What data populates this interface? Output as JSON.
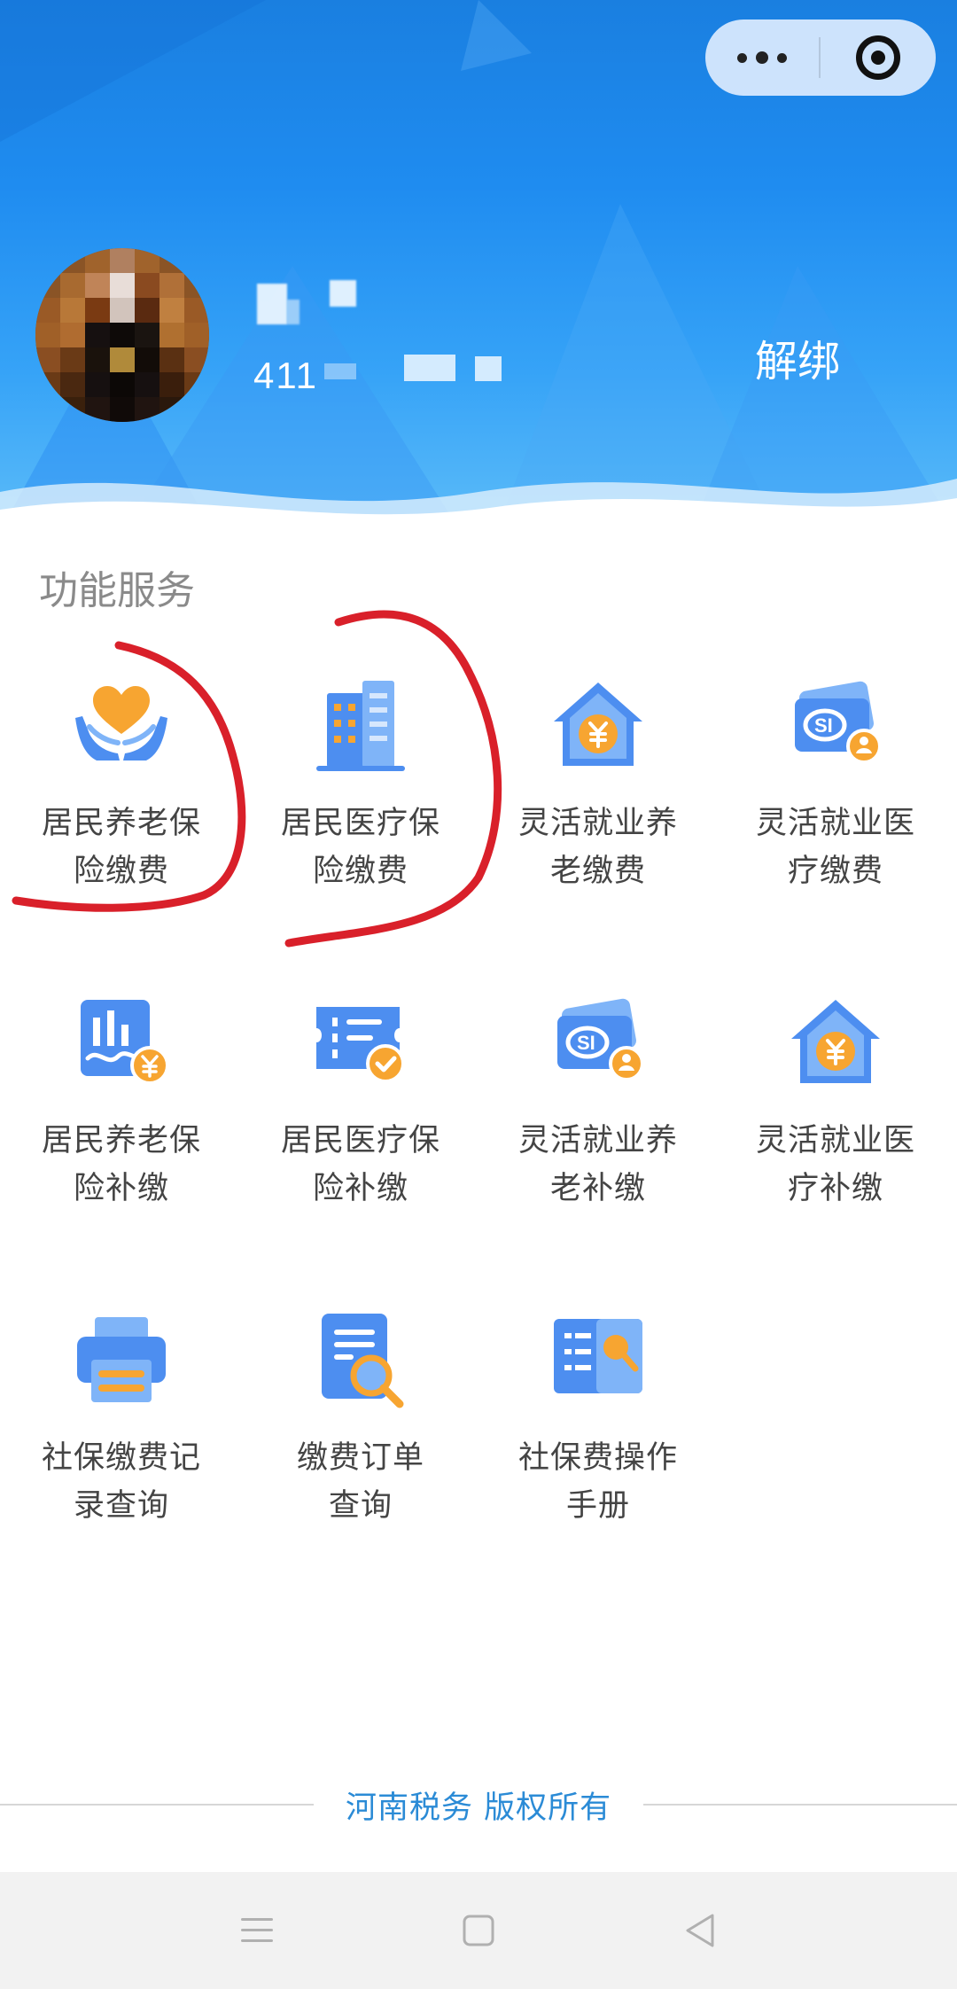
{
  "header": {
    "user_id_visible": "411",
    "unbind_label": "解绑"
  },
  "section": {
    "title": "功能服务"
  },
  "services": [
    {
      "line1": "居民养老保",
      "line2": "险缴费",
      "icon": "heart-hands-icon"
    },
    {
      "line1": "居民医疗保",
      "line2": "险缴费",
      "icon": "hospital-building-icon"
    },
    {
      "line1": "灵活就业养",
      "line2": "老缴费",
      "icon": "house-yuan-icon"
    },
    {
      "line1": "灵活就业医",
      "line2": "疗缴费",
      "icon": "si-card-icon"
    },
    {
      "line1": "居民养老保",
      "line2": "险补缴",
      "icon": "chart-yuan-icon"
    },
    {
      "line1": "居民医疗保",
      "line2": "险补缴",
      "icon": "ticket-check-icon"
    },
    {
      "line1": "灵活就业养",
      "line2": "老补缴",
      "icon": "si-card-icon"
    },
    {
      "line1": "灵活就业医",
      "line2": "疗补缴",
      "icon": "house-yuan-icon"
    },
    {
      "line1": "社保缴费记",
      "line2": "录查询",
      "icon": "printer-icon"
    },
    {
      "line1": "缴费订单",
      "line2": "查询",
      "icon": "document-search-icon"
    },
    {
      "line1": "社保费操作",
      "line2": "手册",
      "icon": "book-search-icon"
    }
  ],
  "footer": {
    "copyright": "河南税务 版权所有"
  },
  "colors": {
    "icon_blue": "#4d8ef0",
    "icon_light_blue": "#7fb4f8",
    "icon_orange": "#f7a531",
    "annotation_red": "#d9202a",
    "footer_text": "#2b8bd6"
  }
}
